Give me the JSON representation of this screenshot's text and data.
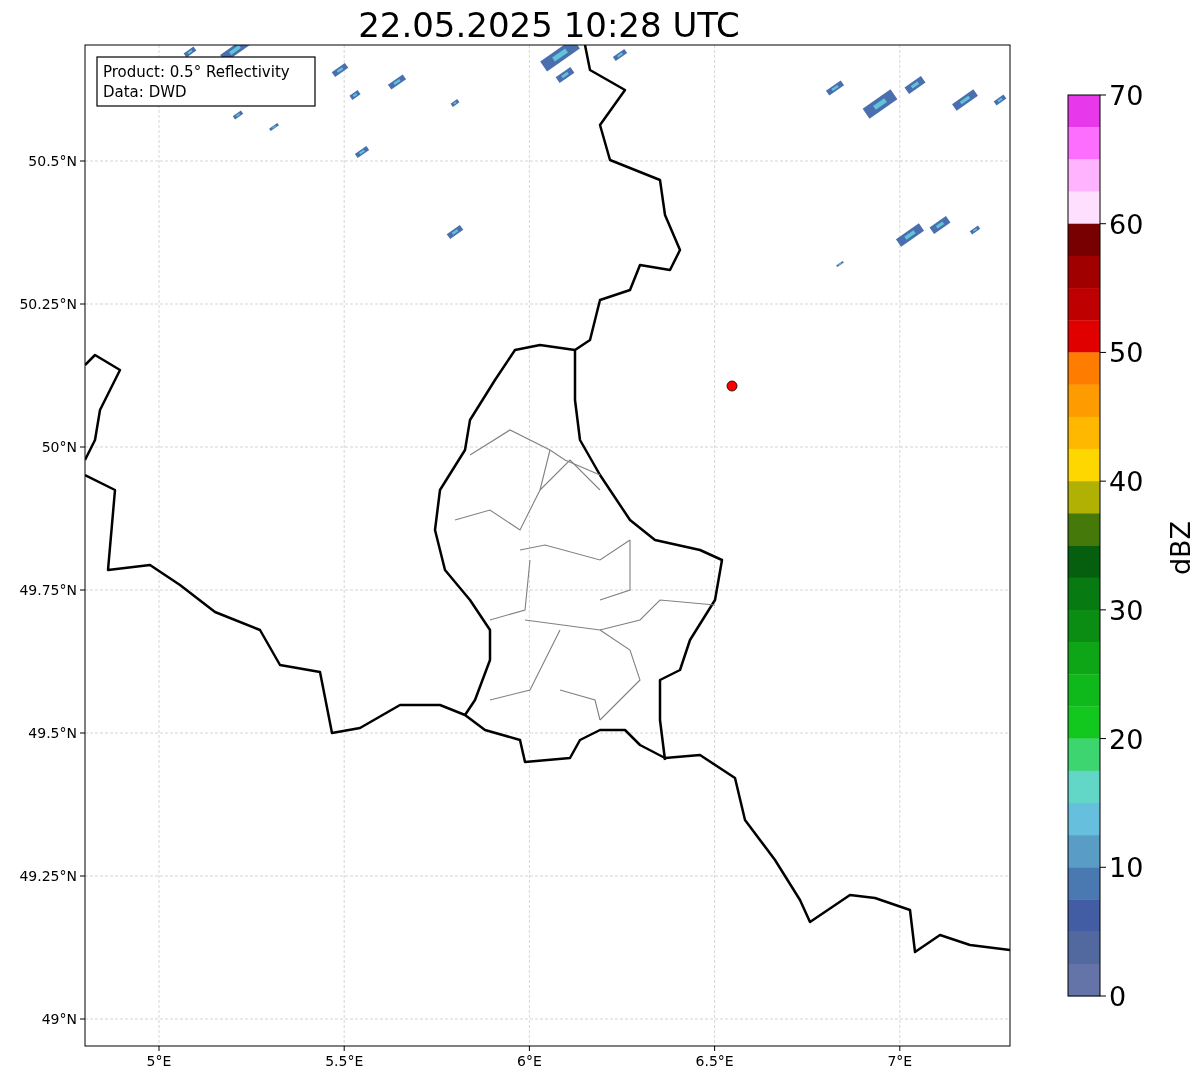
{
  "title": "22.05.2025 10:28 UTC",
  "info_box": {
    "lines": [
      "Product: 0.5° Reflectivity",
      "Data: DWD"
    ]
  },
  "map": {
    "latitude_labels": [
      "50.5°N",
      "50.25°N",
      "50°N",
      "49.75°N",
      "49.5°N",
      "49.25°N",
      "49°N"
    ],
    "longitude_labels": [
      "5°E",
      "5.5°E",
      "6°E",
      "6.5°E",
      "7°E"
    ]
  },
  "colorbar": {
    "label": "dBZ",
    "tick_labels": [
      "70",
      "60",
      "50",
      "40",
      "30",
      "20",
      "10",
      "0"
    ],
    "bins": [
      {
        "color": "#e838ec"
      },
      {
        "color": "#fe6efe"
      },
      {
        "color": "#ffb2fe"
      },
      {
        "color": "#fee0fe"
      },
      {
        "color": "#780000"
      },
      {
        "color": "#a00000"
      },
      {
        "color": "#be0000"
      },
      {
        "color": "#e10000"
      },
      {
        "color": "#fe7d00"
      },
      {
        "color": "#fe9b00"
      },
      {
        "color": "#feb800"
      },
      {
        "color": "#fed700"
      },
      {
        "color": "#b1b104"
      },
      {
        "color": "#457a0a"
      },
      {
        "color": "#055f0f"
      },
      {
        "color": "#087a12"
      },
      {
        "color": "#0b8d14"
      },
      {
        "color": "#0ea516"
      },
      {
        "color": "#10b91b"
      },
      {
        "color": "#12c81e"
      },
      {
        "color": "#3dd56f"
      },
      {
        "color": "#62d7c7"
      },
      {
        "color": "#66c0dd"
      },
      {
        "color": "#599dc6"
      },
      {
        "color": "#4a79b2"
      },
      {
        "color": "#425da3"
      },
      {
        "color": "#52699f"
      },
      {
        "color": "#6474a8"
      }
    ]
  }
}
